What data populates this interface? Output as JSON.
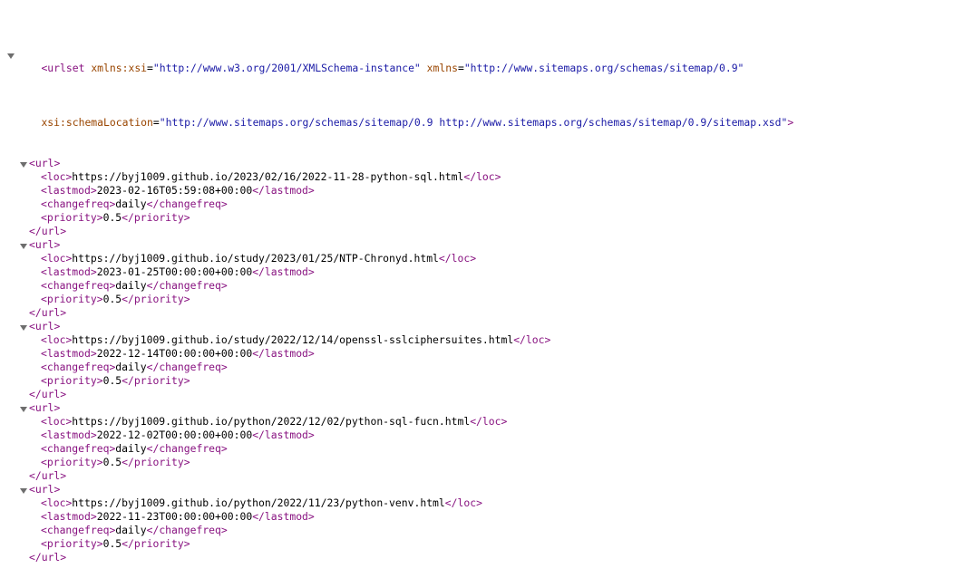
{
  "urlset": {
    "open_name": "urlset",
    "close_name": "urlset",
    "attrs": [
      {
        "name": "xmlns:xsi",
        "value": "\"http://www.w3.org/2001/XMLSchema-instance\""
      },
      {
        "name": "xmlns",
        "value": "\"http://www.sitemaps.org/schemas/sitemap/0.9\""
      }
    ],
    "schema_attr": {
      "name": "xsi:schemaLocation",
      "value": "\"http://www.sitemaps.org/schemas/sitemap/0.9 http://www.sitemaps.org/schemas/sitemap/0.9/sitemap.xsd\""
    }
  },
  "tags": {
    "url": "url",
    "loc": "loc",
    "lastmod": "lastmod",
    "changefreq": "changefreq",
    "priority": "priority"
  },
  "entries": [
    {
      "loc": "https://byj1009.github.io/2023/02/16/2022-11-28-python-sql.html",
      "lastmod": "2023-02-16T05:59:08+00:00",
      "changefreq": "daily",
      "priority": "0.5"
    },
    {
      "loc": "https://byj1009.github.io/study/2023/01/25/NTP-Chronyd.html",
      "lastmod": "2023-01-25T00:00:00+00:00",
      "changefreq": "daily",
      "priority": "0.5"
    },
    {
      "loc": "https://byj1009.github.io/study/2022/12/14/openssl-sslciphersuites.html",
      "lastmod": "2022-12-14T00:00:00+00:00",
      "changefreq": "daily",
      "priority": "0.5"
    },
    {
      "loc": "https://byj1009.github.io/python/2022/12/02/python-sql-fucn.html",
      "lastmod": "2022-12-02T00:00:00+00:00",
      "changefreq": "daily",
      "priority": "0.5"
    },
    {
      "loc": "https://byj1009.github.io/python/2022/11/23/python-venv.html",
      "lastmod": "2022-11-23T00:00:00+00:00",
      "changefreq": "daily",
      "priority": "0.5"
    }
  ],
  "colors": {
    "tag": "#881280",
    "attr_name": "#994500",
    "attr_value": "#1a1aa6",
    "text": "#000000",
    "toggle": "#6e6e6e"
  },
  "icons": {
    "toggle": "triangle-down-icon"
  }
}
